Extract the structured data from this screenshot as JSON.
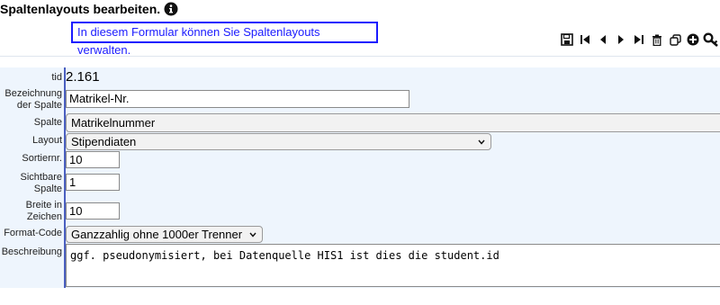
{
  "page": {
    "title": "Spaltenlayouts bearbeiten.",
    "notice": "In diesem Formular können Sie Spaltenlayouts verwalten."
  },
  "toolbar": {
    "icons": [
      "save-icon",
      "first-record-icon",
      "previous-record-icon",
      "next-record-icon",
      "last-record-icon",
      "delete-icon",
      "copy-icon",
      "add-icon",
      "key-search-icon"
    ]
  },
  "form": {
    "tid": {
      "label": "tid",
      "value": "2.161"
    },
    "bezeichnung": {
      "label_line1": "Bezeichnung",
      "label_line2": "der Spalte",
      "value": "Matrikel-Nr."
    },
    "spalte": {
      "label": "Spalte",
      "value": "Matrikelnummer"
    },
    "layout": {
      "label": "Layout",
      "value": "Stipendiaten"
    },
    "sortiernr": {
      "label": "Sortiernr.",
      "value": "10"
    },
    "sichtbare_spalte": {
      "label_line1": "Sichtbare",
      "label_line2": "Spalte",
      "value": "1"
    },
    "breite": {
      "label_line1": "Breite in",
      "label_line2": "Zeichen",
      "value": "10"
    },
    "format_code": {
      "label": "Format-Code",
      "value": "Ganzzahlig ohne 1000er Trenner"
    },
    "beschreibung": {
      "label": "Beschreibung",
      "value": "ggf. pseudonymisiert, bei Datenquelle HIS1 ist dies die student.id"
    }
  },
  "colors": {
    "accent": "#1a1aff",
    "form_bg": "#eef5fd",
    "divider": "#4a5fc0"
  }
}
